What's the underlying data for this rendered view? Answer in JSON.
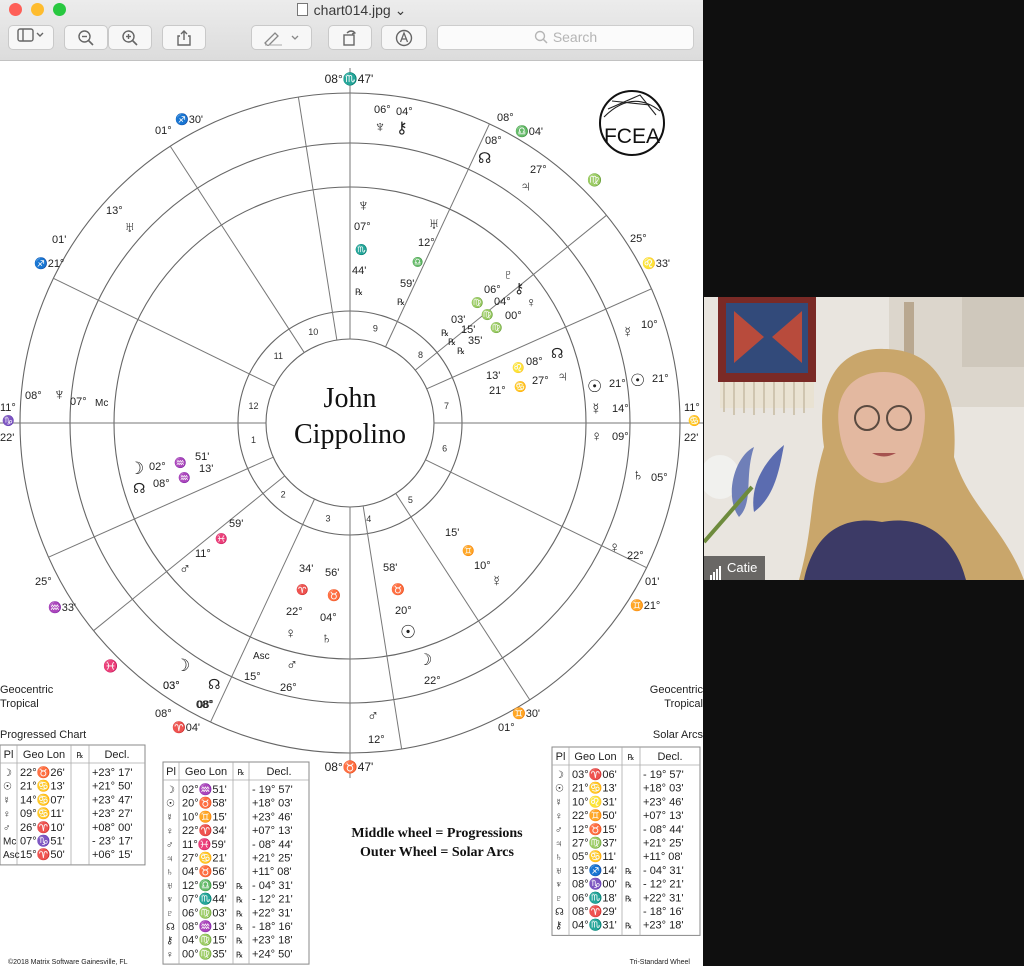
{
  "window": {
    "file_name": "chart014.jpg",
    "search_placeholder": "Search",
    "traffic_colors": [
      "#fe5f57",
      "#febc2e",
      "#28c840"
    ]
  },
  "chart": {
    "client_name_line1": "John",
    "client_name_line2": "Cippolino",
    "logo_text": "FCEA",
    "houses": [
      "10",
      "9",
      "8",
      "7",
      "6",
      "5",
      "4",
      "3",
      "2",
      "1",
      "12",
      "11"
    ],
    "axis": {
      "top": "08°♏47'",
      "bottom": "08°♉47'",
      "left_top": "11°",
      "left_mid": "♑",
      "left_bot": "22'",
      "right_top": "11°",
      "right_mid": "♋",
      "right_bot": "22'"
    },
    "outer_cusps": [
      {
        "a": "01°",
        "b": "♐30'"
      },
      {
        "a": "13°",
        "b": "♅"
      },
      {
        "a": "01'",
        "b": "♐21°"
      },
      {
        "a": "25°",
        "b": "♒33'"
      },
      {
        "a": "08°",
        "b": "♈04'"
      },
      {
        "a": "08°",
        "b": "♎04'"
      },
      {
        "a": "25°",
        "b": "♌33'"
      },
      {
        "a": "01'",
        "b": "♊21°"
      },
      {
        "a": "01°",
        "b": "♊30'"
      },
      {
        "a": "03°",
        "b": "08°"
      }
    ],
    "outer_planets": [
      {
        "glyph": "♆",
        "deg": "06°"
      },
      {
        "glyph": "⚷",
        "deg": "04°"
      },
      {
        "glyph": "☊",
        "deg": "08°"
      },
      {
        "glyph": "♃",
        "deg": "27°"
      },
      {
        "glyph": "♍",
        "deg": ""
      },
      {
        "glyph": "☿",
        "deg": "10°"
      },
      {
        "glyph": "☉",
        "deg": "21°"
      },
      {
        "glyph": "♄",
        "deg": "05°"
      },
      {
        "glyph": "♀",
        "deg": "22°"
      },
      {
        "glyph": "♂",
        "deg": "12°"
      },
      {
        "glyph": "☽",
        "deg": "22°"
      },
      {
        "glyph": "♓",
        "deg": ""
      }
    ],
    "left_labels": {
      "line1": "Geocentric",
      "line2": "Tropical",
      "section": "Progressed Chart"
    },
    "right_labels": {
      "line1": "Geocentric",
      "line2": "Tropical",
      "section": "Solar Arcs"
    },
    "legend_line1": "Middle wheel = Progressions",
    "legend_line2": "Outer Wheel = Solar Arcs",
    "footer_left": "©2018 Matrix Software  Gainesville, FL",
    "footer_right": "Tri-Standard Wheel"
  },
  "tables": {
    "headers": [
      "Pl",
      "Geo Lon",
      "℞",
      "Decl."
    ],
    "progressed": [
      [
        "☽",
        "22°♉26'",
        "",
        "+23° 17'"
      ],
      [
        "☉",
        "21°♋13'",
        "",
        "+21° 50'"
      ],
      [
        "☿",
        "14°♋07'",
        "",
        "+23° 47'"
      ],
      [
        "♀",
        "09°♋11'",
        "",
        "+23° 27'"
      ],
      [
        "♂",
        "26°♈10'",
        "",
        "+08° 00'"
      ],
      [
        "Mc",
        "07°♑51'",
        "",
        "- 23° 17'"
      ],
      [
        "Asc",
        "15°♈50'",
        "",
        "+06° 15'"
      ]
    ],
    "natal": [
      [
        "☽",
        "02°♒51'",
        "",
        "- 19° 57'"
      ],
      [
        "☉",
        "20°♉58'",
        "",
        "+18° 03'"
      ],
      [
        "☿",
        "10°♊15'",
        "",
        "+23° 46'"
      ],
      [
        "♀",
        "22°♈34'",
        "",
        "+07° 13'"
      ],
      [
        "♂",
        "11°♓59'",
        "",
        "- 08° 44'"
      ],
      [
        "♃",
        "27°♋21'",
        "",
        "+21° 25'"
      ],
      [
        "♄",
        "04°♉56'",
        "",
        "+11° 08'"
      ],
      [
        "♅",
        "12°♎59'",
        "℞",
        "- 04° 31'"
      ],
      [
        "♆",
        "07°♏44'",
        "℞",
        "- 12° 21'"
      ],
      [
        "♇",
        "06°♍03'",
        "℞",
        "+22° 31'"
      ],
      [
        "☊",
        "08°♒13'",
        "℞",
        "- 18° 16'"
      ],
      [
        "⚷",
        "04°♍15'",
        "℞",
        "+23° 18'"
      ],
      [
        "♀",
        "00°♍35'",
        "℞",
        "+24° 50'"
      ]
    ],
    "solar_arcs": [
      [
        "☽",
        "03°♈06'",
        "",
        "- 19° 57'"
      ],
      [
        "☉",
        "21°♋13'",
        "",
        "+18° 03'"
      ],
      [
        "☿",
        "10°♌31'",
        "",
        "+23° 46'"
      ],
      [
        "♀",
        "22°♊50'",
        "",
        "+07° 13'"
      ],
      [
        "♂",
        "12°♉15'",
        "",
        "- 08° 44'"
      ],
      [
        "♃",
        "27°♍37'",
        "",
        "+21° 25'"
      ],
      [
        "♄",
        "05°♋11'",
        "",
        "+11° 08'"
      ],
      [
        "♅",
        "13°♐14'",
        "℞",
        "- 04° 31'"
      ],
      [
        "♆",
        "08°♑00'",
        "℞",
        "- 12° 21'"
      ],
      [
        "♇",
        "06°♏18'",
        "℞",
        "+22° 31'"
      ],
      [
        "☊",
        "08°♈29'",
        "",
        "- 18° 16'"
      ],
      [
        "⚷",
        "04°♏31'",
        "℞",
        "+23° 18'"
      ]
    ]
  },
  "participant": {
    "name": "Catie"
  }
}
